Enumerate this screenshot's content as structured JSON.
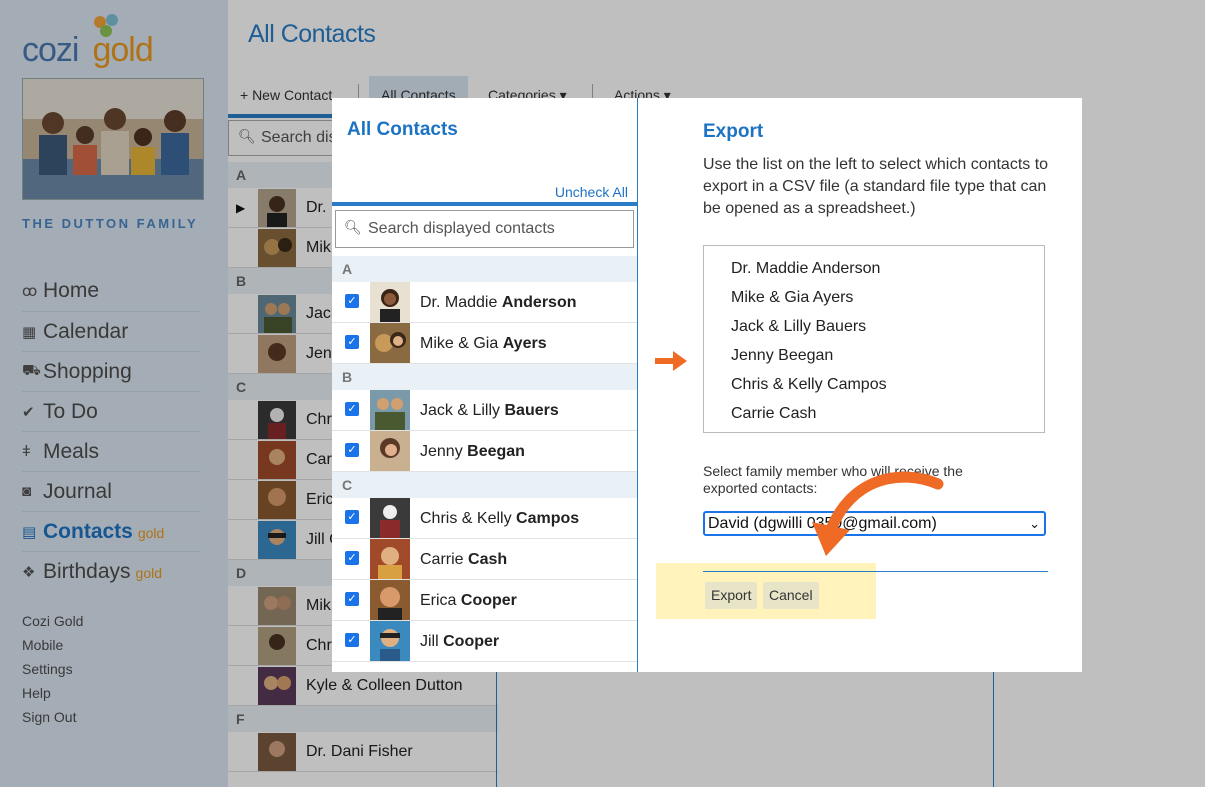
{
  "app": {
    "logo_text": "cozi",
    "logo_gold": "gold",
    "family_name": "THE DUTTON FAMILY"
  },
  "sidebar": {
    "nav": [
      {
        "label": "Home",
        "icon": "home-icon",
        "gold": ""
      },
      {
        "label": "Calendar",
        "icon": "calendar-icon",
        "gold": ""
      },
      {
        "label": "Shopping",
        "icon": "cart-icon",
        "gold": ""
      },
      {
        "label": "To Do",
        "icon": "checkmark-icon",
        "gold": ""
      },
      {
        "label": "Meals",
        "icon": "utensils-icon",
        "gold": ""
      },
      {
        "label": "Journal",
        "icon": "camera-icon",
        "gold": ""
      },
      {
        "label": "Contacts",
        "icon": "contacts-icon",
        "gold": "gold"
      },
      {
        "label": "Birthdays",
        "icon": "gift-icon",
        "gold": "gold"
      }
    ],
    "footer": [
      "Cozi Gold",
      "Mobile",
      "Settings",
      "Help",
      "Sign Out"
    ]
  },
  "main": {
    "title": "All Contacts",
    "toolbar": {
      "new_contact": "+ New Contact",
      "all_contacts": "All Contacts",
      "categories": "Categories ▾",
      "actions": "Actions ▾"
    },
    "search_placeholder": "Search dis",
    "letters": [
      "A",
      "B",
      "C",
      "D",
      "F"
    ],
    "rows": [
      "Dr.",
      "Mik",
      "Jack",
      "Jenn",
      "Chr",
      "Car",
      "Eric",
      "Jill C",
      "Mik",
      "Chris Dutton",
      "Kyle & Colleen Dutton",
      "Dr. Dani Fisher"
    ]
  },
  "dialog": {
    "left": {
      "title": "All Contacts",
      "uncheck_all": "Uncheck All",
      "search_placeholder": "Search displayed contacts",
      "groups": [
        {
          "letter": "A",
          "contacts": [
            {
              "first": "Dr. Maddie",
              "last": "Anderson"
            },
            {
              "first": "Mike & Gia",
              "last": "Ayers"
            }
          ]
        },
        {
          "letter": "B",
          "contacts": [
            {
              "first": "Jack & Lilly",
              "last": "Bauers"
            },
            {
              "first": "Jenny",
              "last": "Beegan"
            }
          ]
        },
        {
          "letter": "C",
          "contacts": [
            {
              "first": "Chris & Kelly",
              "last": "Campos"
            },
            {
              "first": "Carrie",
              "last": "Cash"
            },
            {
              "first": "Erica",
              "last": "Cooper"
            },
            {
              "first": "Jill",
              "last": "Cooper"
            }
          ]
        }
      ]
    },
    "right": {
      "title": "Export",
      "description": "Use the list on the left to select which contacts to export in a CSV file (a standard file type that can be opened as a spreadsheet.)",
      "selected": [
        "Dr. Maddie Anderson",
        "Mike & Gia Ayers",
        "Jack & Lilly Bauers",
        "Jenny Beegan",
        "Chris & Kelly Campos",
        "Carrie Cash"
      ],
      "recipient_label": "Select family member who will receive the exported contacts:",
      "recipient_value": "David (dgwilli      0359@gmail.com)",
      "export_button": "Export",
      "cancel_button": "Cancel"
    }
  },
  "colors": {
    "accent_blue": "#1c73c4",
    "gold": "#e89a1e",
    "annotation_orange": "#ee6a25"
  }
}
